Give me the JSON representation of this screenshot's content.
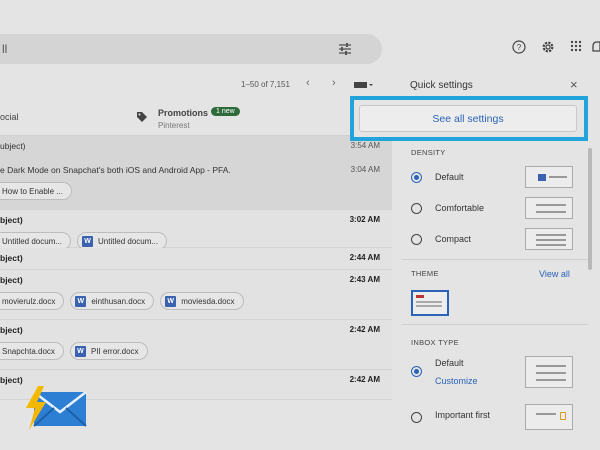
{
  "search": {
    "partial_text": "ll"
  },
  "icons": [
    "filter-icon",
    "help-icon",
    "settings-gear-icon",
    "apps-grid-icon",
    "notification-icon"
  ],
  "pager": {
    "range": "1–50 of 7,151",
    "prev": "‹",
    "next": "›"
  },
  "tabs": {
    "social_label": "ocial",
    "promotions_label": "Promotions",
    "promotions_badge": "1 new",
    "promotions_sub": "Pinterest"
  },
  "rows": [
    {
      "subject": "ubject)",
      "time": "3:54 AM",
      "read": true,
      "chips": []
    },
    {
      "subject": "e Dark Mode on Snapchat's both iOS and Android App - PFA.",
      "time": "3:04 AM",
      "read": true,
      "chips": [
        {
          "label": "How to Enable ...",
          "icon": false
        }
      ]
    },
    {
      "subject": "bject)",
      "time": "3:02 AM",
      "read": false,
      "chips": [
        {
          "label": "Untitled docum...",
          "icon": false
        },
        {
          "label": "Untitled docum...",
          "icon": true
        }
      ]
    },
    {
      "subject": "bject)",
      "time": "2:44 AM",
      "read": false,
      "chips": []
    },
    {
      "subject": "bject)",
      "time": "2:43 AM",
      "read": false,
      "chips": [
        {
          "label": "movierulz.docx",
          "icon": false
        },
        {
          "label": "einthusan.docx",
          "icon": true
        },
        {
          "label": "moviesda.docx",
          "icon": true
        }
      ]
    },
    {
      "subject": "bject)",
      "time": "2:42 AM",
      "read": false,
      "chips": [
        {
          "label": "Snapchta.docx",
          "icon": false
        },
        {
          "label": "PII error.docx",
          "icon": true
        }
      ]
    },
    {
      "subject": "bject)",
      "time": "2:42 AM",
      "read": false,
      "chips": []
    }
  ],
  "quick_settings": {
    "title": "Quick settings",
    "close": "×",
    "see_all": "See all settings",
    "density_label": "DENSITY",
    "density_options": [
      "Default",
      "Comfortable",
      "Compact"
    ],
    "density_selected": 0,
    "theme_label": "THEME",
    "view_all": "View all",
    "inbox_type_label": "INBOX TYPE",
    "inbox_options": [
      "Default",
      "Important first"
    ],
    "customize": "Customize"
  },
  "colors": {
    "accent": "#2a63b8",
    "highlight": "#22a3d9",
    "badge": "#2f6b3a"
  }
}
